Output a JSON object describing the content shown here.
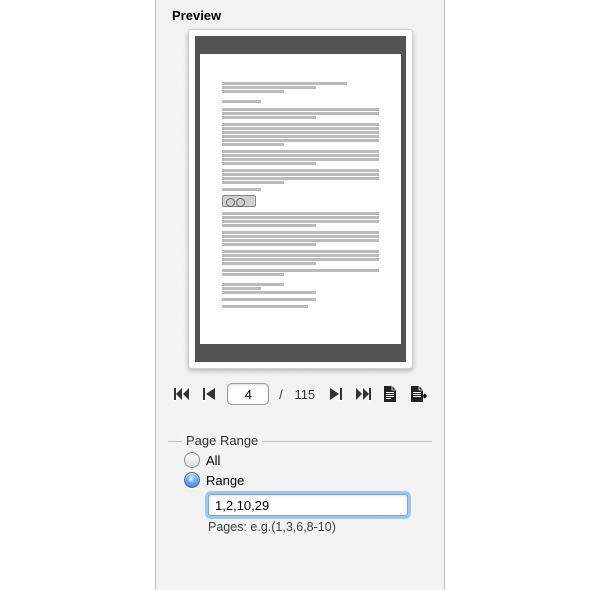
{
  "preview": {
    "label": "Preview",
    "current_page": "4",
    "page_sep": "/",
    "total_pages": "115"
  },
  "page_range": {
    "legend": "Page Range",
    "all_label": "All",
    "range_label": "Range",
    "selected": "range",
    "range_value": "1,2,10,29",
    "hint": "Pages: e.g.(1,3,6,8-10)"
  },
  "icons": {
    "first": "first-page-icon",
    "prev": "prev-page-icon",
    "next": "next-page-icon",
    "last": "last-page-icon",
    "doc_a": "single-page-icon",
    "doc_b": "export-page-icon"
  },
  "colors": {
    "focus_ring": "#6fb0f2",
    "radio_selected": "#2a78c9"
  }
}
